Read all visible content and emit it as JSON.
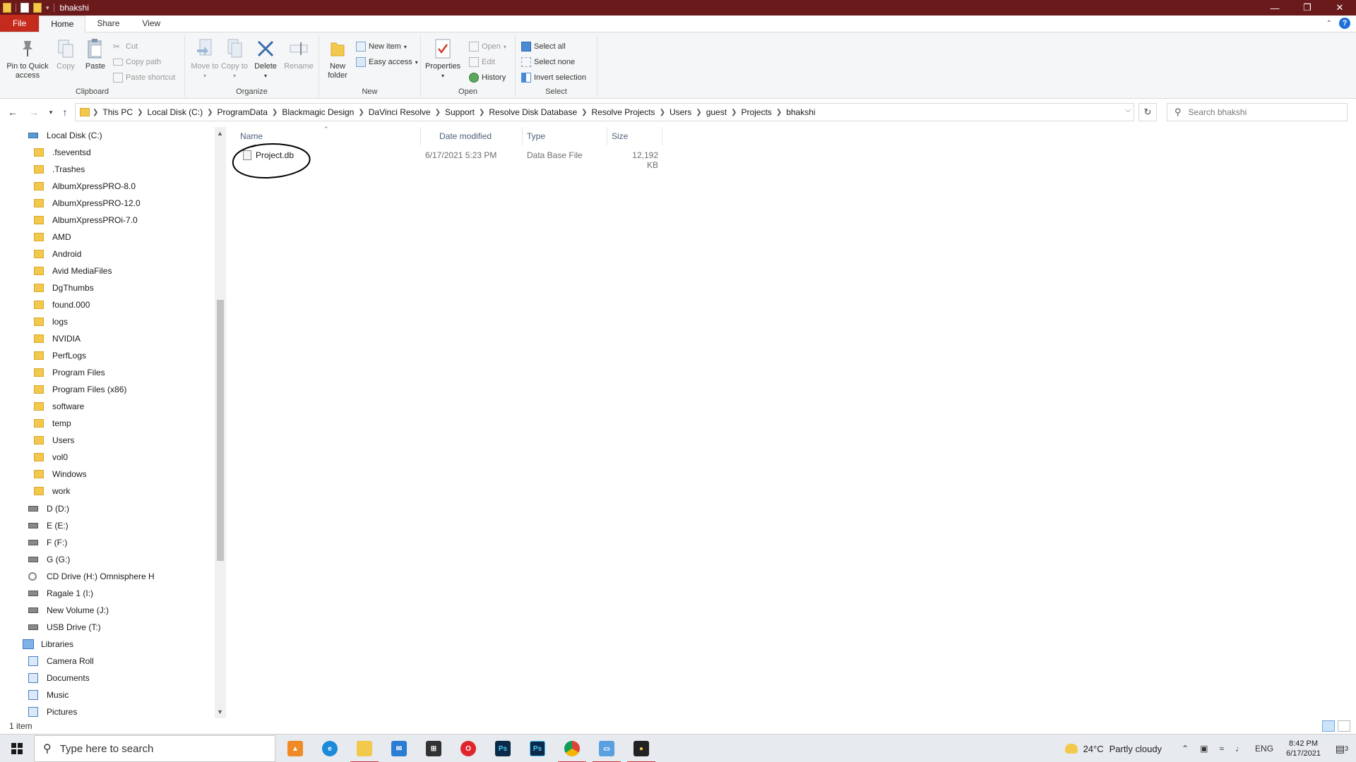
{
  "window": {
    "title": "bhakshi",
    "controls": [
      "minimize",
      "maximize",
      "close"
    ]
  },
  "ribbon": {
    "tabs": [
      "File",
      "Home",
      "Share",
      "View"
    ],
    "clipboard": {
      "label": "Clipboard",
      "pin": "Pin to Quick access",
      "copy": "Copy",
      "paste": "Paste",
      "cut": "Cut",
      "copy_path": "Copy path",
      "paste_shortcut": "Paste shortcut"
    },
    "organize": {
      "label": "Organize",
      "move_to": "Move to",
      "copy_to": "Copy to",
      "delete": "Delete",
      "rename": "Rename"
    },
    "new": {
      "label": "New",
      "new_folder": "New folder",
      "new_item": "New item",
      "easy_access": "Easy access"
    },
    "open": {
      "label": "Open",
      "properties": "Properties",
      "open": "Open",
      "edit": "Edit",
      "history": "History"
    },
    "select": {
      "label": "Select",
      "select_all": "Select all",
      "select_none": "Select none",
      "invert_selection": "Invert selection"
    }
  },
  "address": {
    "crumbs": [
      "This PC",
      "Local Disk (C:)",
      "ProgramData",
      "Blackmagic Design",
      "DaVinci Resolve",
      "Support",
      "Resolve Disk Database",
      "Resolve Projects",
      "Users",
      "guest",
      "Projects",
      "bhakshi"
    ],
    "search_placeholder": "Search bhakshi"
  },
  "nav_pane": {
    "drive_c": "Local Disk (C:)",
    "folders": [
      ".fseventsd",
      ".Trashes",
      "AlbumXpressPRO-8.0",
      "AlbumXpressPRO-12.0",
      "AlbumXpressPROi-7.0",
      "AMD",
      "Android",
      "Avid MediaFiles",
      "DgThumbs",
      "found.000",
      "logs",
      "NVIDIA",
      "PerfLogs",
      "Program Files",
      "Program Files (x86)",
      "software",
      "temp",
      "Users",
      "vol0",
      "Windows",
      "work"
    ],
    "drives": [
      "D (D:)",
      "E (E:)",
      "F (F:)",
      "G (G:)",
      "CD Drive (H:) Omnisphere H",
      "Ragale 1 (I:)",
      "New Volume (J:)",
      "USB Drive (T:)"
    ],
    "libraries": "Libraries",
    "library_items": [
      "Camera Roll",
      "Documents",
      "Music",
      "Pictures"
    ]
  },
  "file_list": {
    "columns": [
      "Name",
      "Date modified",
      "Type",
      "Size"
    ],
    "rows": [
      {
        "name": "Project.db",
        "date": "6/17/2021 5:23 PM",
        "type": "Data Base File",
        "size": "12,192 KB"
      }
    ]
  },
  "status": {
    "count": "1 item"
  },
  "taskbar": {
    "search_placeholder": "Type here to search",
    "weather_temp": "24°C",
    "weather_desc": "Partly cloudy",
    "language": "ENG",
    "time": "8:42 PM",
    "date": "6/17/2021",
    "notifications": "3"
  }
}
